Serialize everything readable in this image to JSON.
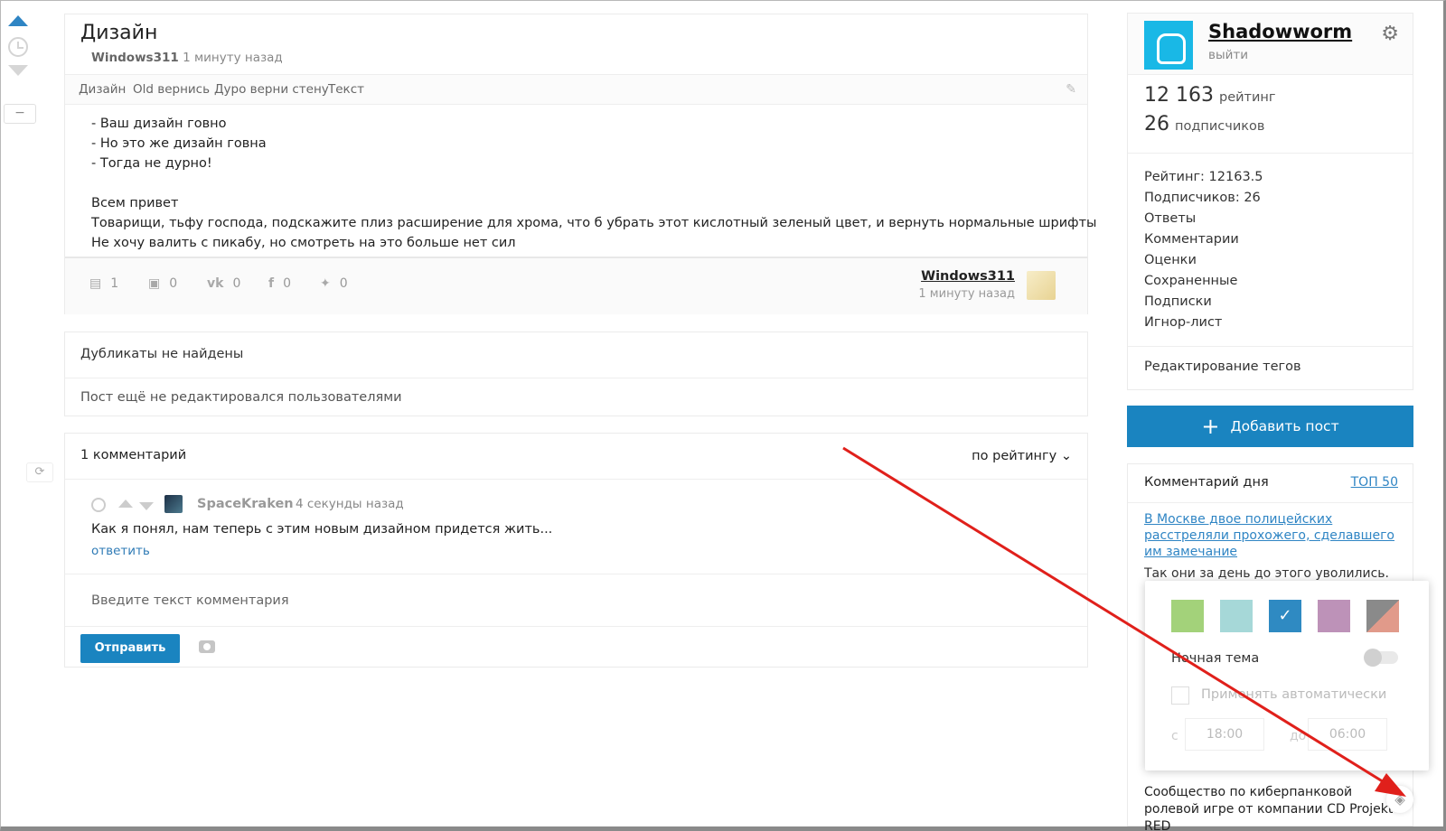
{
  "post": {
    "title": "Дизайн",
    "author": "Windows311",
    "time": "1 минуту назад",
    "tags": [
      "Дизайн",
      "Old вернись",
      "Дуро верни стену",
      "Текст"
    ],
    "body": [
      "- Ваш дизайн говно",
      "- Но это же дизайн говна",
      "- Тогда не дурно!",
      "",
      "Всем привет",
      "Товарищи, тьфу господа, подскажите плиз расширение для хрома, что б убрать этот кислотный зеленый цвет, и вернуть нормальные шрифты",
      "Не хочу валить с пикабу, но смотреть на это больше нет сил"
    ],
    "stats": {
      "comments": "1",
      "saves": "0",
      "vk": "0",
      "fb": "0",
      "tw": "0"
    },
    "footer_author": "Windows311",
    "footer_time": "1 минуту назад"
  },
  "dupes": {
    "line1": "Дубликаты не найдены",
    "line2": "Пост ещё не редактировался пользователями"
  },
  "comments": {
    "count_label": "1 комментарий",
    "sort_label": "по рейтингу",
    "item": {
      "author": "SpaceKraken",
      "time": "4 секунды назад",
      "text": "Как я понял, нам теперь с этим новым дизайном придется жить...",
      "reply": "ответить"
    },
    "input_placeholder": "Введите текст комментария",
    "send": "Отправить"
  },
  "profile": {
    "name": "Shadowworm",
    "logout": "выйти",
    "rating": "12 163",
    "rating_label": "рейтинг",
    "subs": "26",
    "subs_label": "подписчиков",
    "list": [
      "Рейтинг: 12163.5",
      "Подписчиков: 26",
      "Ответы",
      "Комментарии",
      "Оценки",
      "Сохраненные",
      "Подписки",
      "Игнор-лист"
    ],
    "edit_tags": "Редактирование тегов"
  },
  "add_post": "Добавить пост",
  "comment_of_day": {
    "title": "Комментарий дня",
    "top": "ТОП 50",
    "link": "В Москве двое полицейских расстреляли прохожего, сделавшего им замечание",
    "text": "Так они за день до этого уволились.",
    "community": "Сообщество по киберпанковой ролевой игре от компании CD Projekt RED"
  },
  "theme": {
    "swatches": [
      "#a3d27a",
      "#a6d8d8",
      "#2f8ac2",
      "#bd92b8",
      "#8a8a8a"
    ],
    "selected": 2,
    "night": "Ночная тема",
    "auto": "Применять автоматически",
    "from": "с",
    "from_time": "18:00",
    "to": "до",
    "to_time": "06:00"
  },
  "colors": {
    "accent": "#1a84c0",
    "annotation_arrow": "#e0201b"
  }
}
